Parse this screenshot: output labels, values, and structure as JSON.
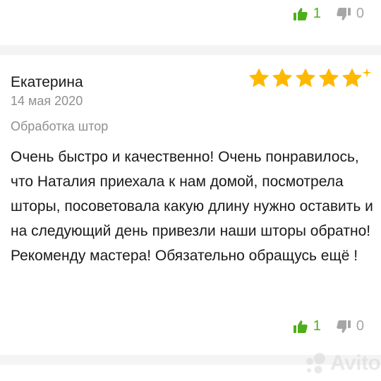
{
  "top_votes": {
    "likes": "1",
    "dislikes": "0"
  },
  "review": {
    "author": "Екатерина",
    "date": "14 мая 2020",
    "service": "Обработка штор",
    "rating": 5,
    "text": "Очень быстро и качественно! Очень понравилось, что Наталия приехала к нам домой, посмотрела шторы, посоветовала какую длину нужно оставить и на следующий день привезли наши шторы обратно! Рекоменду мастера! Обязательно обращусь ещё !",
    "likes": "1",
    "dislikes": "0"
  },
  "watermark": "Avito",
  "colors": {
    "like": "#4caf1a",
    "star": "#ffb800",
    "muted": "#8f8f8f"
  },
  "icons": {
    "like": "thumbs-up-icon",
    "dislike": "thumbs-down-icon",
    "star": "star-icon"
  }
}
